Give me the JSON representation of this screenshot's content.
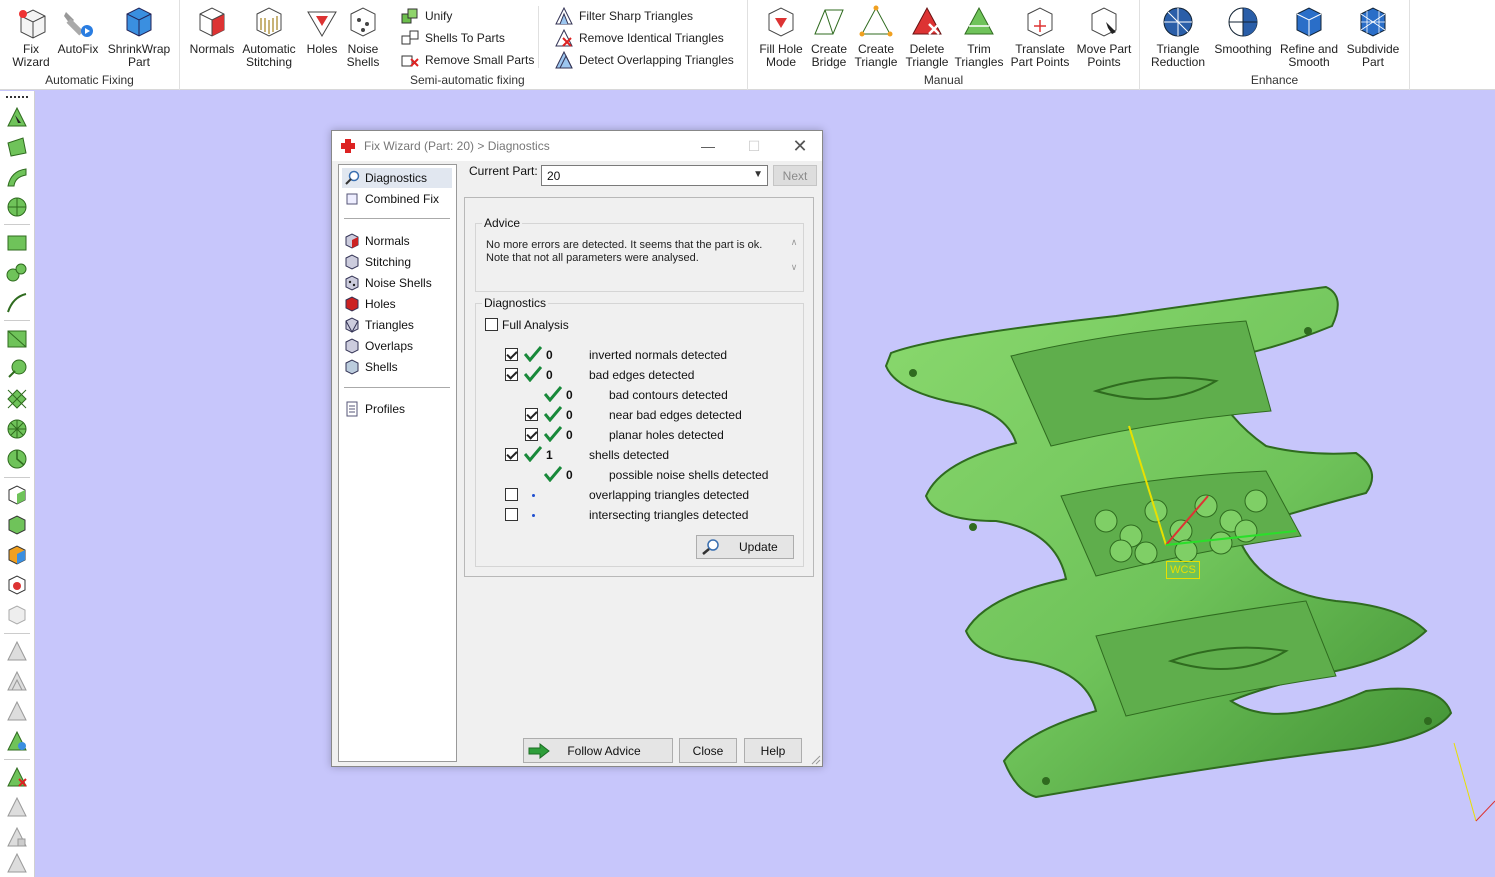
{
  "ribbon": {
    "groups": {
      "automatic_fixing": "Automatic Fixing",
      "semi_automatic": "Semi-automatic fixing",
      "manual": "Manual",
      "enhance": "Enhance"
    },
    "buttons": {
      "fix_wizard": "Fix\nWizard",
      "autofix": "AutoFix",
      "shrinkwrap": "ShrinkWrap\nPart",
      "normals": "Normals",
      "auto_stitch": "Automatic\nStitching",
      "holes": "Holes",
      "noise_shells": "Noise\nShells",
      "unify": "Unify",
      "shells_to_parts": "Shells To Parts",
      "remove_small_parts": "Remove Small Parts",
      "filter_sharp": "Filter Sharp Triangles",
      "remove_identical": "Remove Identical Triangles",
      "detect_overlapping": "Detect Overlapping Triangles",
      "fill_hole_mode": "Fill Hole\nMode",
      "create_bridge": "Create\nBridge",
      "create_triangle": "Create\nTriangle",
      "delete_triangle": "Delete\nTriangle",
      "trim_triangles": "Trim\nTriangles",
      "translate_part_points": "Translate\nPart Points",
      "move_part_points": "Move Part\nPoints",
      "triangle_reduction": "Triangle\nReduction",
      "smoothing": "Smoothing",
      "refine_smooth": "Refine and\nSmooth",
      "subdivide_part": "Subdivide\nPart"
    }
  },
  "dialog": {
    "title": "Fix Wizard (Part: 20) > Diagnostics",
    "nav": {
      "diagnostics": "Diagnostics",
      "combined_fix": "Combined Fix",
      "normals": "Normals",
      "stitching": "Stitching",
      "noise_shells": "Noise Shells",
      "holes": "Holes",
      "triangles": "Triangles",
      "overlaps": "Overlaps",
      "shells": "Shells",
      "profiles": "Profiles"
    },
    "current_part_label": "Current Part:",
    "current_part_value": "20",
    "next_button": "Next",
    "advice_title": "Advice",
    "advice_line1": "No more errors are detected. It seems that the part is ok.",
    "advice_line2": "Note that not all parameters were analysed.",
    "diagnostics_title": "Diagnostics",
    "full_analysis": "Full Analysis",
    "rows": [
      {
        "count": "0",
        "label": "inverted normals detected"
      },
      {
        "count": "0",
        "label": "bad edges detected"
      },
      {
        "count": "0",
        "label": "bad contours detected"
      },
      {
        "count": "0",
        "label": "near bad edges detected"
      },
      {
        "count": "0",
        "label": "planar holes detected"
      },
      {
        "count": "1",
        "label": "shells detected"
      },
      {
        "count": "0",
        "label": "possible noise shells detected"
      },
      {
        "count": "",
        "label": "overlapping triangles detected"
      },
      {
        "count": "",
        "label": "intersecting triangles detected"
      }
    ],
    "update_button": "Update",
    "follow_advice_button": "Follow Advice",
    "close_button": "Close",
    "help_button": "Help"
  },
  "viewport": {
    "wcs_label": "WCS",
    "part_color": "#6fc35a",
    "background": "#c7c6fb"
  }
}
